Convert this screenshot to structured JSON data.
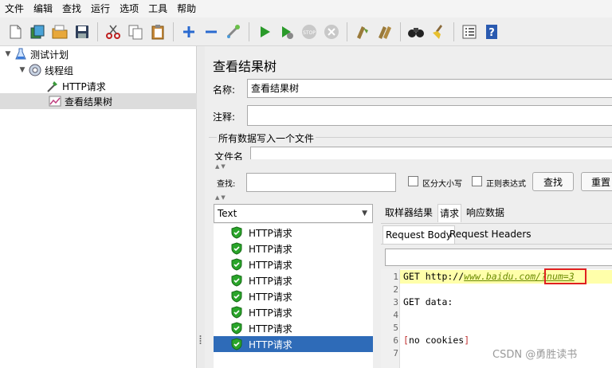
{
  "menu": [
    "文件",
    "编辑",
    "查找",
    "运行",
    "选项",
    "工具",
    "帮助"
  ],
  "toolbar_icons": [
    "new-icon",
    "templates-icon",
    "open-icon",
    "save-icon",
    "cut-icon",
    "copy-icon",
    "paste-icon",
    "expand-icon",
    "collapse-icon",
    "toggle-icon",
    "start-icon",
    "start-no-pauses-icon",
    "stop-icon",
    "shutdown-icon",
    "clear-icon",
    "clear-all-icon",
    "search-icon",
    "reset-search-icon",
    "function-helper-icon",
    "help-icon"
  ],
  "tree": {
    "items": [
      {
        "label": "测试计划",
        "icon": "test-plan-icon"
      },
      {
        "label": "线程组",
        "icon": "thread-group-icon"
      },
      {
        "label": "HTTP请求",
        "icon": "sampler-icon"
      },
      {
        "label": "查看结果树",
        "icon": "listener-icon"
      }
    ]
  },
  "panel": {
    "title": "查看结果树",
    "name_label": "名称:",
    "name_value": "查看结果树",
    "comment_label": "注释:",
    "comment_value": "",
    "write_all_label": "所有数据写入一个文件",
    "filename_label": "文件名"
  },
  "search": {
    "label": "查找:",
    "value": "",
    "case_label": "区分大小写",
    "regex_label": "正则表达式",
    "find_button": "查找",
    "reset_button": "重置"
  },
  "renderer": {
    "selected": "Text"
  },
  "results": {
    "items": [
      "HTTP请求",
      "HTTP请求",
      "HTTP请求",
      "HTTP请求",
      "HTTP请求",
      "HTTP请求",
      "HTTP请求",
      "HTTP请求"
    ],
    "selected_index": 7
  },
  "tabs": {
    "main": [
      "取样器结果",
      "请求",
      "响应数据"
    ],
    "sub": [
      "Request Body",
      "Request Headers"
    ]
  },
  "code": {
    "line_numbers": [
      "1",
      "2",
      "3",
      "4",
      "5",
      "6",
      "7"
    ],
    "line1_prefix": "GET http://",
    "line1_link": "www.baidu.com/?",
    "line1_param": "num=3",
    "line3": "GET data:",
    "line6": "[no cookies]"
  },
  "watermark": "CSDN @勇胜读书",
  "colors": {
    "selection": "#2e6bb8",
    "highlight_line": "#ffffaa",
    "param_box": "#e02020",
    "shield": "#2aa52a",
    "link": "#6a8a00"
  }
}
